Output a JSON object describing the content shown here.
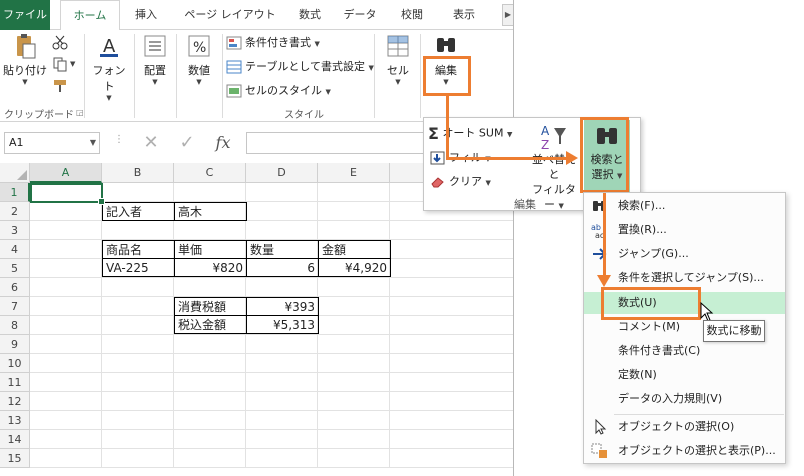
{
  "tabs": [
    {
      "label": "ファイル",
      "active": false
    },
    {
      "label": "ホーム",
      "active": true
    },
    {
      "label": "挿入",
      "active": false
    },
    {
      "label": "ページ レイアウト",
      "active": false
    },
    {
      "label": "数式",
      "active": false
    },
    {
      "label": "データ",
      "active": false
    },
    {
      "label": "校閲",
      "active": false
    },
    {
      "label": "表示",
      "active": false
    }
  ],
  "ribbon": {
    "paste": "貼り付け",
    "clipboard": "クリップボード",
    "font": "フォント",
    "alignment": "配置",
    "number": "数値",
    "cond_format": "条件付き書式",
    "format_table": "テーブルとして書式設定",
    "cell_styles": "セルのスタイル",
    "styles": "スタイル",
    "cells": "セル",
    "editing": "編集"
  },
  "formula_bar": {
    "name_box": "A1",
    "fx": "fx",
    "value": ""
  },
  "columns": [
    "A",
    "B",
    "C",
    "D",
    "E"
  ],
  "rows": [
    "1",
    "2",
    "3",
    "4",
    "5",
    "6",
    "7",
    "8",
    "9",
    "10",
    "11",
    "12",
    "13",
    "14",
    "15"
  ],
  "sheet": {
    "b2": "記入者",
    "c2": "高木",
    "b4": "商品名",
    "c4": "単価",
    "d4": "数量",
    "e4": "金額",
    "b5": "VA-225",
    "c5": "¥820",
    "d5": "6",
    "e5": "¥4,920",
    "c7": "消費税額",
    "d7": "¥393",
    "c8": "税込金額",
    "d8": "¥5,313"
  },
  "edit_panel": {
    "autosum": "オート SUM",
    "fill": "フィル",
    "clear": "クリア",
    "sort_filter": "並べ替えと\nフィルター",
    "sort_filter_l1": "並べ替えと",
    "sort_filter_l2": "フィルター",
    "find_select_l1": "検索と",
    "find_select_l2": "選択",
    "group_label": "編集"
  },
  "find_menu": {
    "find": "検索(F)...",
    "replace": "置換(R)...",
    "goto": "ジャンプ(G)...",
    "goto_special": "条件を選択してジャンプ(S)...",
    "formulas": "数式(U)",
    "comments": "コメント(M)",
    "cond_formatting": "条件付き書式(C)",
    "constants": "定数(N)",
    "data_validation": "データの入力規則(V)",
    "select_objects": "オブジェクトの選択(O)",
    "selection_pane": "オブジェクトの選択と表示(P)..."
  },
  "tooltip": "数式に移動",
  "colors": {
    "accent": "#217346",
    "highlight": "#ed7d31",
    "menu_hover": "#c6efd3"
  }
}
